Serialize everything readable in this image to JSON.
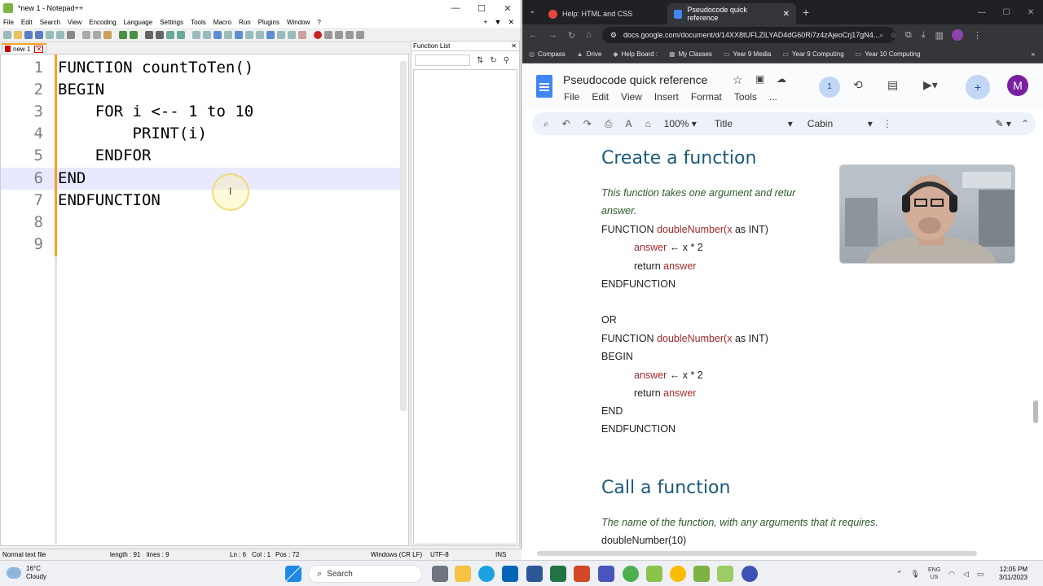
{
  "npp": {
    "title": "*new 1 - Notepad++",
    "menu": [
      "File",
      "Edit",
      "Search",
      "View",
      "Encoding",
      "Language",
      "Settings",
      "Tools",
      "Macro",
      "Run",
      "Plugins",
      "Window",
      "?"
    ],
    "tab_label": "new 1",
    "lines": [
      {
        "n": "1",
        "text": "FUNCTION countToTen()"
      },
      {
        "n": "2",
        "text": "BEGIN"
      },
      {
        "n": "3",
        "text": "    FOR i <-- 1 to 10"
      },
      {
        "n": "4",
        "text": "        PRINT(i)"
      },
      {
        "n": "5",
        "text": "    ENDFOR"
      },
      {
        "n": "6",
        "text": "END"
      },
      {
        "n": "7",
        "text": "ENDFUNCTION"
      },
      {
        "n": "8",
        "text": ""
      },
      {
        "n": "9",
        "text": ""
      }
    ],
    "function_list_title": "Function List",
    "status": {
      "type": "Normal text file",
      "length": "length : 91",
      "lines": "lines : 9",
      "ln": "Ln : 6",
      "col": "Col : 1",
      "pos": "Pos : 72",
      "eol": "Windows (CR LF)",
      "encoding": "UTF-8",
      "mode": "INS"
    }
  },
  "chrome": {
    "tabs": [
      {
        "label": "Help: HTML and CSS",
        "color": "#e8453c"
      },
      {
        "label": "Pseudocode quick reference",
        "color": "#4285f4"
      }
    ],
    "url": "docs.google.com/document/d/14XX8tUFLZlLYAD4dG60Ri7z4zAjeoCrj17gN4...",
    "bookmarks": [
      "Compass",
      "Drive",
      "Help Board :",
      "My Classes",
      "Year 9 Media",
      "Year 9 Computing",
      "Year 10 Computing"
    ]
  },
  "docs": {
    "title": "Pseudocode quick reference",
    "menu": [
      "File",
      "Edit",
      "View",
      "Insert",
      "Format",
      "Tools",
      "..."
    ],
    "collab_count": "1",
    "avatar_letter": "M",
    "zoom": "100%",
    "style": "Title",
    "font": "Cabin",
    "h_create": "Create a function",
    "create_desc_1": "This function takes one argument and retur",
    "create_desc_2": "answer.",
    "ex1": {
      "l1_kw": "FUNCTION ",
      "l1_name": "doubleNumber(x",
      "l1_rest": " as INT)",
      "l2_var": "answer",
      "l2_rest": " ← x * 2",
      "l3_kw": "return ",
      "l3_var": "answer",
      "l4": "ENDFUNCTION"
    },
    "or": "OR",
    "ex2": {
      "l1_kw": "FUNCTION ",
      "l1_name": "doubleNumber(x",
      "l1_rest": " as INT)",
      "l2": "BEGIN",
      "l3_var": "answer",
      "l3_rest": " ← x * 2",
      "l4_kw": "return ",
      "l4_var": "answer",
      "l5": "END",
      "l6": "ENDFUNCTION"
    },
    "h_call": "Call a function",
    "call_desc": "The name of the function, with any arguments that it requires.",
    "call_example": "doubleNumber(10)"
  },
  "taskbar": {
    "temp": "16°C",
    "weather": "Cloudy",
    "search": "Search",
    "lang1": "ENG",
    "lang2": "US",
    "time": "12:05 PM",
    "date": "3/11/2023"
  }
}
